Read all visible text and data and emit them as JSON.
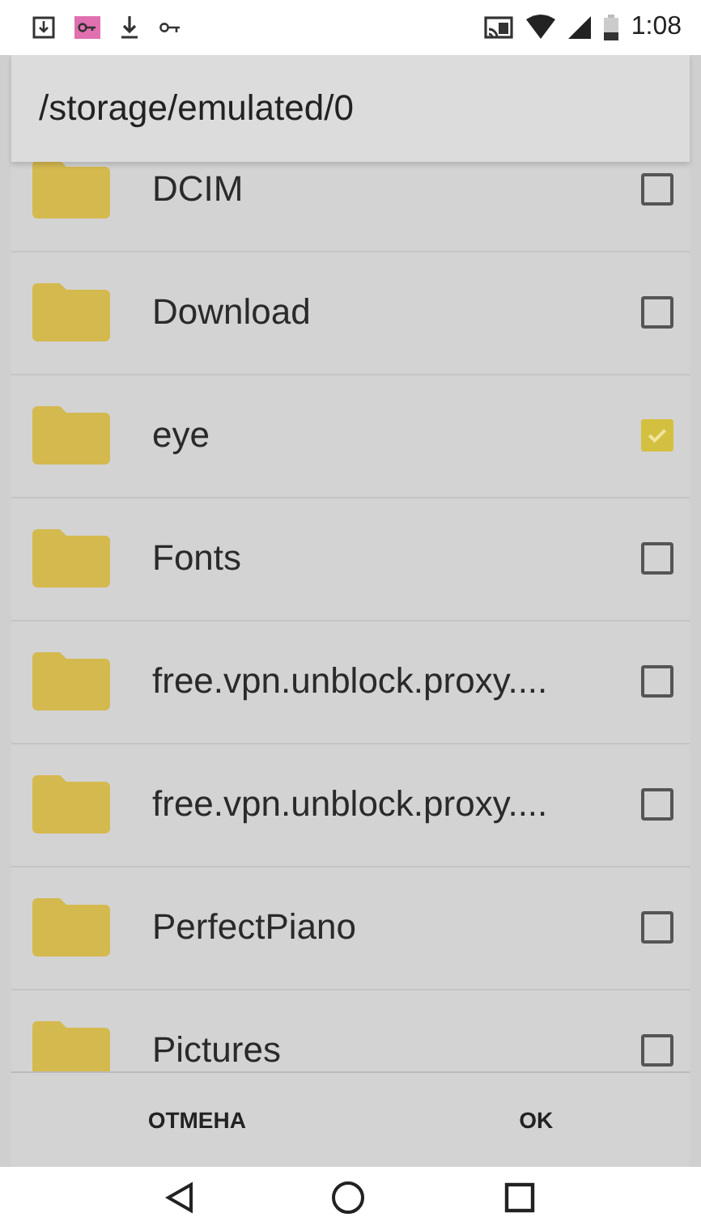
{
  "status_bar": {
    "time": "1:08"
  },
  "dialog": {
    "title": "/storage/emulated/0",
    "folders": [
      {
        "name": "DCIM",
        "checked": false
      },
      {
        "name": "Download",
        "checked": false
      },
      {
        "name": "eye",
        "checked": true
      },
      {
        "name": "Fonts",
        "checked": false
      },
      {
        "name": "free.vpn.unblock.proxy....",
        "checked": false
      },
      {
        "name": "free.vpn.unblock.proxy....",
        "checked": false
      },
      {
        "name": "PerfectPiano",
        "checked": false
      },
      {
        "name": "Pictures",
        "checked": false
      }
    ],
    "buttons": [
      "ОТМЕНА",
      "OK"
    ]
  }
}
